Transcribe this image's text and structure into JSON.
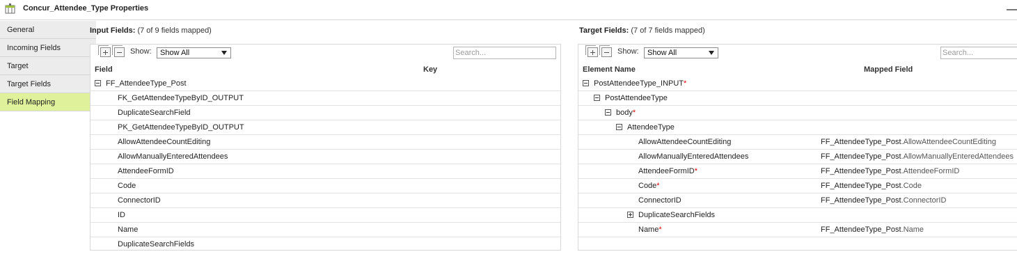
{
  "window": {
    "title": "Concur_Attendee_Type Properties",
    "icon": "table-icon"
  },
  "nav": {
    "items": [
      {
        "label": "General",
        "active": false
      },
      {
        "label": "Incoming Fields",
        "active": false
      },
      {
        "label": "Target",
        "active": false
      },
      {
        "label": "Target Fields",
        "active": false
      },
      {
        "label": "Field Mapping",
        "active": true
      }
    ]
  },
  "input_panel": {
    "heading": "Input Fields:",
    "summary": "(7 of 9 fields mapped)",
    "show_label": "Show:",
    "show_value": "Show All",
    "search_placeholder": "Search...",
    "columns": {
      "field": "Field",
      "key": "Key"
    },
    "root": "FF_AttendeeType_Post",
    "fields": [
      "FK_GetAttendeeTypeByID_OUTPUT",
      "DuplicateSearchField",
      "PK_GetAttendeeTypeByID_OUTPUT",
      "AllowAttendeeCountEditing",
      "AllowManuallyEnteredAttendees",
      "AttendeeFormID",
      "Code",
      "ConnectorID",
      "ID",
      "Name",
      "DuplicateSearchFields"
    ]
  },
  "target_panel": {
    "heading": "Target Fields:",
    "summary": "(7 of 7 fields mapped)",
    "show_label": "Show:",
    "show_value": "Show All",
    "search_placeholder": "Search...",
    "columns": {
      "element": "Element Name",
      "mapped": "Mapped Field"
    },
    "tree": {
      "root": "PostAttendeeType_INPUT",
      "root_required": "*",
      "level1": "PostAttendeeType",
      "level2": "body",
      "level2_required": "*",
      "level3": "AttendeeType"
    },
    "elements": [
      {
        "name": "AllowAttendeeCountEditing",
        "required": "",
        "mapped_src": "FF_AttendeeType_Post",
        "mapped_field": ".AllowAttendeeCountEditing"
      },
      {
        "name": "AllowManuallyEnteredAttendees",
        "required": "",
        "mapped_src": "FF_AttendeeType_Post",
        "mapped_field": ".AllowManuallyEnteredAttendees"
      },
      {
        "name": "AttendeeFormID",
        "required": "*",
        "mapped_src": "FF_AttendeeType_Post",
        "mapped_field": ".AttendeeFormID"
      },
      {
        "name": "Code",
        "required": "*",
        "mapped_src": "FF_AttendeeType_Post",
        "mapped_field": ".Code"
      },
      {
        "name": "ConnectorID",
        "required": "",
        "mapped_src": "FF_AttendeeType_Post",
        "mapped_field": ".ConnectorID"
      },
      {
        "name": "DuplicateSearchFields",
        "required": "",
        "mapped_src": "",
        "mapped_field": ""
      },
      {
        "name": "Name",
        "required": "*",
        "mapped_src": "FF_AttendeeType_Post",
        "mapped_field": ".Name"
      }
    ]
  }
}
